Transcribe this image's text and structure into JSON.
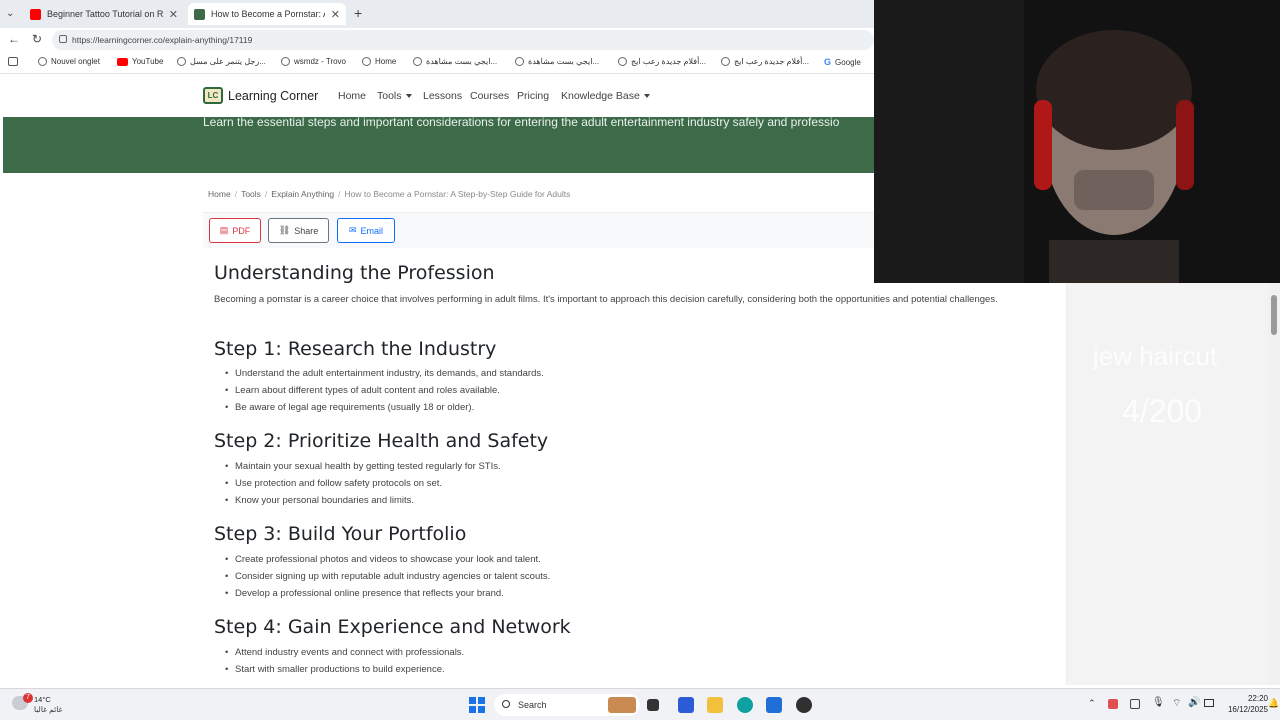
{
  "browser": {
    "tabs": [
      {
        "title": "Beginner Tattoo Tutorial on Real S",
        "active": false
      },
      {
        "title": "How to Become a Pornstar: A Step",
        "active": true
      }
    ],
    "url": "https://learningcorner.co/explain-anything/17119",
    "bookmarks": [
      "Nouvel onglet",
      "YouTube",
      "رجل يتنمر على مسل...",
      "wsmdz - Trovo",
      "Home",
      "ايجي بست مشاهدة...",
      "ايجي بست مشاهدة...",
      "أفلام جديدة رعب ايج...",
      "أفلام جديدة رعب ايج...",
      "Google"
    ]
  },
  "site": {
    "brand": "Learning Corner",
    "brand_mark": "LC",
    "nav": {
      "home": "Home",
      "tools": "Tools",
      "lessons": "Lessons",
      "courses": "Courses",
      "pricing": "Pricing",
      "knowledge": "Knowledge Base"
    },
    "hero_text": "Learn the essential steps and important considerations for entering the adult entertainment industry safely and professio",
    "breadcrumb": {
      "home": "Home",
      "tools": "Tools",
      "explain": "Explain Anything",
      "current": "How to Become a Pornstar: A Step-by-Step Guide for Adults"
    },
    "actions": {
      "pdf": "PDF",
      "share": "Share",
      "email": "Email"
    }
  },
  "article": {
    "intro_heading": "Understanding the Profession",
    "intro_text": "Becoming a pornstar is a career choice that involves performing in adult films. It's important to approach this decision carefully, considering both the opportunities and potential challenges.",
    "steps": [
      {
        "heading": "Step 1: Research the Industry",
        "items": [
          "Understand the adult entertainment industry, its demands, and standards.",
          "Learn about different types of adult content and roles available.",
          "Be aware of legal age requirements (usually 18 or older)."
        ]
      },
      {
        "heading": "Step 2: Prioritize Health and Safety",
        "items": [
          "Maintain your sexual health by getting tested regularly for STIs.",
          "Use protection and follow safety protocols on set.",
          "Know your personal boundaries and limits."
        ]
      },
      {
        "heading": "Step 3: Build Your Portfolio",
        "items": [
          "Create professional photos and videos to showcase your look and talent.",
          "Consider signing up with reputable adult industry agencies or talent scouts.",
          "Develop a professional online presence that reflects your brand."
        ]
      },
      {
        "heading": "Step 4: Gain Experience and Network",
        "items": [
          "Attend industry events and connect with professionals.",
          "Start with smaller productions to build experience."
        ]
      }
    ]
  },
  "overlay": {
    "line1": "jew haircut",
    "line2": "4/200"
  },
  "taskbar": {
    "weather_temp": "14°C",
    "weather_desc": "غائم غالبا",
    "search_placeholder": "Search",
    "time": "22:20",
    "date": "16/12/2025",
    "notification_count": "7"
  },
  "colors": {
    "hero_green": "#3d6b4a",
    "pdf_red": "#dc3545",
    "email_blue": "#0d6efd"
  }
}
